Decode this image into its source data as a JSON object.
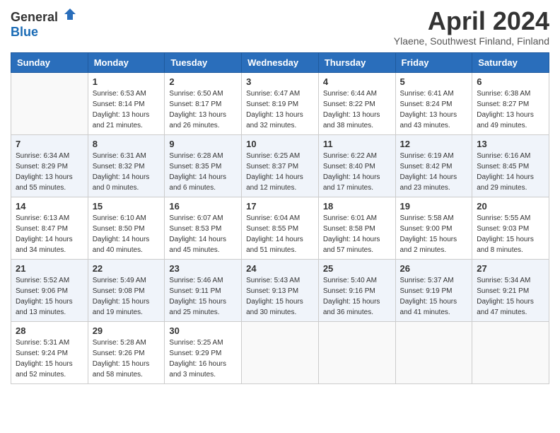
{
  "header": {
    "logo_general": "General",
    "logo_blue": "Blue",
    "month_title": "April 2024",
    "location": "Ylaene, Southwest Finland, Finland"
  },
  "calendar": {
    "days_of_week": [
      "Sunday",
      "Monday",
      "Tuesday",
      "Wednesday",
      "Thursday",
      "Friday",
      "Saturday"
    ],
    "weeks": [
      [
        {
          "day": "",
          "info": ""
        },
        {
          "day": "1",
          "info": "Sunrise: 6:53 AM\nSunset: 8:14 PM\nDaylight: 13 hours\nand 21 minutes."
        },
        {
          "day": "2",
          "info": "Sunrise: 6:50 AM\nSunset: 8:17 PM\nDaylight: 13 hours\nand 26 minutes."
        },
        {
          "day": "3",
          "info": "Sunrise: 6:47 AM\nSunset: 8:19 PM\nDaylight: 13 hours\nand 32 minutes."
        },
        {
          "day": "4",
          "info": "Sunrise: 6:44 AM\nSunset: 8:22 PM\nDaylight: 13 hours\nand 38 minutes."
        },
        {
          "day": "5",
          "info": "Sunrise: 6:41 AM\nSunset: 8:24 PM\nDaylight: 13 hours\nand 43 minutes."
        },
        {
          "day": "6",
          "info": "Sunrise: 6:38 AM\nSunset: 8:27 PM\nDaylight: 13 hours\nand 49 minutes."
        }
      ],
      [
        {
          "day": "7",
          "info": "Sunrise: 6:34 AM\nSunset: 8:29 PM\nDaylight: 13 hours\nand 55 minutes."
        },
        {
          "day": "8",
          "info": "Sunrise: 6:31 AM\nSunset: 8:32 PM\nDaylight: 14 hours\nand 0 minutes."
        },
        {
          "day": "9",
          "info": "Sunrise: 6:28 AM\nSunset: 8:35 PM\nDaylight: 14 hours\nand 6 minutes."
        },
        {
          "day": "10",
          "info": "Sunrise: 6:25 AM\nSunset: 8:37 PM\nDaylight: 14 hours\nand 12 minutes."
        },
        {
          "day": "11",
          "info": "Sunrise: 6:22 AM\nSunset: 8:40 PM\nDaylight: 14 hours\nand 17 minutes."
        },
        {
          "day": "12",
          "info": "Sunrise: 6:19 AM\nSunset: 8:42 PM\nDaylight: 14 hours\nand 23 minutes."
        },
        {
          "day": "13",
          "info": "Sunrise: 6:16 AM\nSunset: 8:45 PM\nDaylight: 14 hours\nand 29 minutes."
        }
      ],
      [
        {
          "day": "14",
          "info": "Sunrise: 6:13 AM\nSunset: 8:47 PM\nDaylight: 14 hours\nand 34 minutes."
        },
        {
          "day": "15",
          "info": "Sunrise: 6:10 AM\nSunset: 8:50 PM\nDaylight: 14 hours\nand 40 minutes."
        },
        {
          "day": "16",
          "info": "Sunrise: 6:07 AM\nSunset: 8:53 PM\nDaylight: 14 hours\nand 45 minutes."
        },
        {
          "day": "17",
          "info": "Sunrise: 6:04 AM\nSunset: 8:55 PM\nDaylight: 14 hours\nand 51 minutes."
        },
        {
          "day": "18",
          "info": "Sunrise: 6:01 AM\nSunset: 8:58 PM\nDaylight: 14 hours\nand 57 minutes."
        },
        {
          "day": "19",
          "info": "Sunrise: 5:58 AM\nSunset: 9:00 PM\nDaylight: 15 hours\nand 2 minutes."
        },
        {
          "day": "20",
          "info": "Sunrise: 5:55 AM\nSunset: 9:03 PM\nDaylight: 15 hours\nand 8 minutes."
        }
      ],
      [
        {
          "day": "21",
          "info": "Sunrise: 5:52 AM\nSunset: 9:06 PM\nDaylight: 15 hours\nand 13 minutes."
        },
        {
          "day": "22",
          "info": "Sunrise: 5:49 AM\nSunset: 9:08 PM\nDaylight: 15 hours\nand 19 minutes."
        },
        {
          "day": "23",
          "info": "Sunrise: 5:46 AM\nSunset: 9:11 PM\nDaylight: 15 hours\nand 25 minutes."
        },
        {
          "day": "24",
          "info": "Sunrise: 5:43 AM\nSunset: 9:13 PM\nDaylight: 15 hours\nand 30 minutes."
        },
        {
          "day": "25",
          "info": "Sunrise: 5:40 AM\nSunset: 9:16 PM\nDaylight: 15 hours\nand 36 minutes."
        },
        {
          "day": "26",
          "info": "Sunrise: 5:37 AM\nSunset: 9:19 PM\nDaylight: 15 hours\nand 41 minutes."
        },
        {
          "day": "27",
          "info": "Sunrise: 5:34 AM\nSunset: 9:21 PM\nDaylight: 15 hours\nand 47 minutes."
        }
      ],
      [
        {
          "day": "28",
          "info": "Sunrise: 5:31 AM\nSunset: 9:24 PM\nDaylight: 15 hours\nand 52 minutes."
        },
        {
          "day": "29",
          "info": "Sunrise: 5:28 AM\nSunset: 9:26 PM\nDaylight: 15 hours\nand 58 minutes."
        },
        {
          "day": "30",
          "info": "Sunrise: 5:25 AM\nSunset: 9:29 PM\nDaylight: 16 hours\nand 3 minutes."
        },
        {
          "day": "",
          "info": ""
        },
        {
          "day": "",
          "info": ""
        },
        {
          "day": "",
          "info": ""
        },
        {
          "day": "",
          "info": ""
        }
      ]
    ]
  }
}
